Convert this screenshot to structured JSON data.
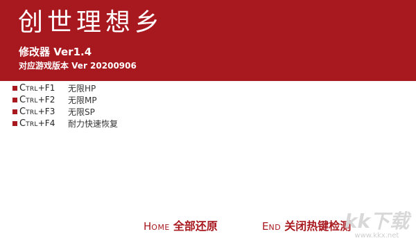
{
  "window": {
    "title": "创世理想乡",
    "subtitle": "修改器 Ver1.4",
    "version_line": "对应游戏版本 Ver 20200906"
  },
  "hotkeys": [
    {
      "key_first": "C",
      "key_rest": "TRL",
      "key_suffix": "+F1",
      "action": "无限HP"
    },
    {
      "key_first": "C",
      "key_rest": "TRL",
      "key_suffix": "+F2",
      "action": "无限MP"
    },
    {
      "key_first": "C",
      "key_rest": "TRL",
      "key_suffix": "+F3",
      "action": "无限SP"
    },
    {
      "key_first": "C",
      "key_rest": "TRL",
      "key_suffix": "+F4",
      "action": "耐力快速恢复"
    }
  ],
  "footer": {
    "home": {
      "key_first": "H",
      "key_rest": "OME",
      "label": "全部还原"
    },
    "end": {
      "key_first": "E",
      "key_rest": "ND",
      "label": "关闭热键检测"
    }
  },
  "watermark": {
    "logo": "kk下载",
    "url": "www.kkx.net"
  },
  "colors": {
    "accent": "#a8191f",
    "background": "#ffffff",
    "banner_text": "#ffffff"
  }
}
